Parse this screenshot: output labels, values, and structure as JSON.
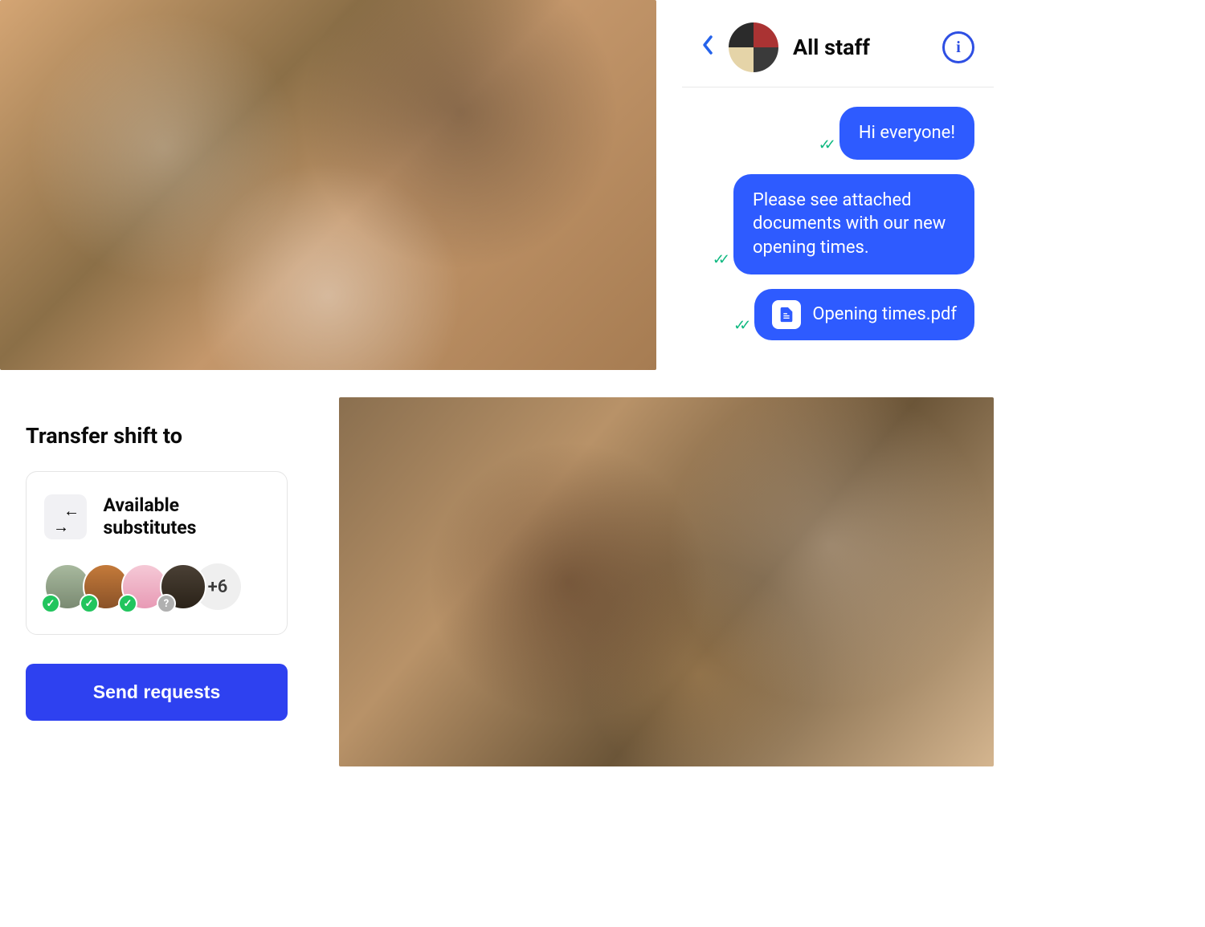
{
  "chat": {
    "title": "All staff",
    "messages": [
      {
        "text": "Hi everyone!"
      },
      {
        "text": "Please see attached documents with our new opening times."
      }
    ],
    "attachment": {
      "filename": "Opening times.pdf"
    }
  },
  "transfer": {
    "title": "Transfer shift to",
    "substitutes_label": "Available substitutes",
    "more_count": "+6",
    "substitutes": [
      {
        "status": "available"
      },
      {
        "status": "available"
      },
      {
        "status": "available"
      },
      {
        "status": "unknown"
      }
    ],
    "send_button": "Send requests"
  }
}
